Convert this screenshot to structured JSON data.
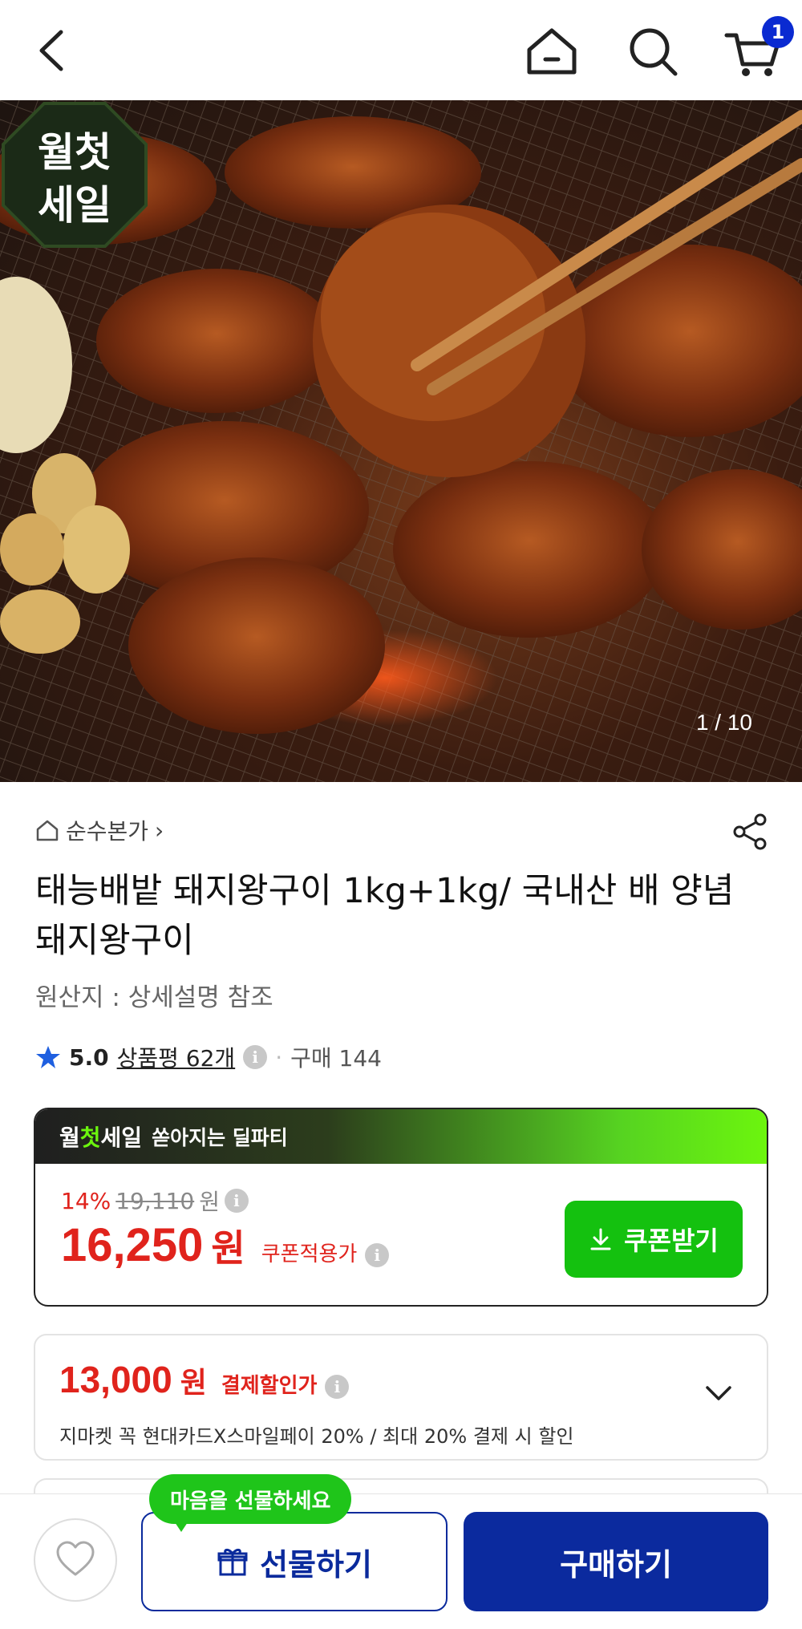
{
  "header": {
    "back_icon": "chevron-left-icon",
    "home_icon": "home-icon",
    "search_icon": "search-icon",
    "cart_icon": "cart-icon",
    "cart_count": "1"
  },
  "gallery": {
    "counter": "1 / 10",
    "badge_line1": "월첫",
    "badge_line2": "세일"
  },
  "product": {
    "seller": "순수본가",
    "seller_chevron": "›",
    "title": "태능배밭 돼지왕구이 1kg+1kg/ 국내산 배 양념 돼지왕구이",
    "origin": "원산지 : 상세설명 참조",
    "rating": "5.0",
    "review_link": "상품평 62개",
    "purchase_count": "구매 144"
  },
  "deal": {
    "brand_part1": "월",
    "brand_part2": "첫",
    "brand_part3": "세일",
    "subtitle": "쏟아지는 딜파티",
    "discount_pct": "14%",
    "original_price": "19,110",
    "original_unit": "원",
    "price": "16,250",
    "price_unit": "원",
    "price_label": "쿠폰적용가",
    "coupon_button": "쿠폰받기"
  },
  "payment": {
    "price": "13,000",
    "unit": "원",
    "label": "결제할인가",
    "description": "지마켓 꼭 현대카드X스마일페이 20% / 최대 20% 결제 시 할인"
  },
  "bottom": {
    "tooltip": "마음을 선물하세요",
    "gift_button": "선물하기",
    "buy_button": "구매하기"
  },
  "colors": {
    "accent_blue": "#0b2a9e",
    "sale_red": "#e0231c",
    "coupon_green": "#14c10f"
  }
}
